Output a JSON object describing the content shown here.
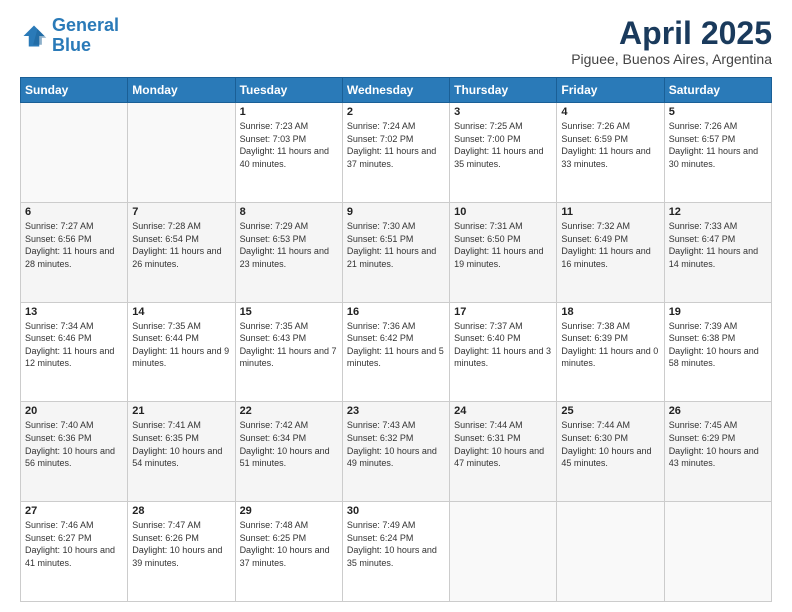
{
  "header": {
    "logo_line1": "General",
    "logo_line2": "Blue",
    "title": "April 2025",
    "subtitle": "Piguee, Buenos Aires, Argentina"
  },
  "weekdays": [
    "Sunday",
    "Monday",
    "Tuesday",
    "Wednesday",
    "Thursday",
    "Friday",
    "Saturday"
  ],
  "weeks": [
    [
      {
        "day": "",
        "info": ""
      },
      {
        "day": "",
        "info": ""
      },
      {
        "day": "1",
        "info": "Sunrise: 7:23 AM\nSunset: 7:03 PM\nDaylight: 11 hours and 40 minutes."
      },
      {
        "day": "2",
        "info": "Sunrise: 7:24 AM\nSunset: 7:02 PM\nDaylight: 11 hours and 37 minutes."
      },
      {
        "day": "3",
        "info": "Sunrise: 7:25 AM\nSunset: 7:00 PM\nDaylight: 11 hours and 35 minutes."
      },
      {
        "day": "4",
        "info": "Sunrise: 7:26 AM\nSunset: 6:59 PM\nDaylight: 11 hours and 33 minutes."
      },
      {
        "day": "5",
        "info": "Sunrise: 7:26 AM\nSunset: 6:57 PM\nDaylight: 11 hours and 30 minutes."
      }
    ],
    [
      {
        "day": "6",
        "info": "Sunrise: 7:27 AM\nSunset: 6:56 PM\nDaylight: 11 hours and 28 minutes."
      },
      {
        "day": "7",
        "info": "Sunrise: 7:28 AM\nSunset: 6:54 PM\nDaylight: 11 hours and 26 minutes."
      },
      {
        "day": "8",
        "info": "Sunrise: 7:29 AM\nSunset: 6:53 PM\nDaylight: 11 hours and 23 minutes."
      },
      {
        "day": "9",
        "info": "Sunrise: 7:30 AM\nSunset: 6:51 PM\nDaylight: 11 hours and 21 minutes."
      },
      {
        "day": "10",
        "info": "Sunrise: 7:31 AM\nSunset: 6:50 PM\nDaylight: 11 hours and 19 minutes."
      },
      {
        "day": "11",
        "info": "Sunrise: 7:32 AM\nSunset: 6:49 PM\nDaylight: 11 hours and 16 minutes."
      },
      {
        "day": "12",
        "info": "Sunrise: 7:33 AM\nSunset: 6:47 PM\nDaylight: 11 hours and 14 minutes."
      }
    ],
    [
      {
        "day": "13",
        "info": "Sunrise: 7:34 AM\nSunset: 6:46 PM\nDaylight: 11 hours and 12 minutes."
      },
      {
        "day": "14",
        "info": "Sunrise: 7:35 AM\nSunset: 6:44 PM\nDaylight: 11 hours and 9 minutes."
      },
      {
        "day": "15",
        "info": "Sunrise: 7:35 AM\nSunset: 6:43 PM\nDaylight: 11 hours and 7 minutes."
      },
      {
        "day": "16",
        "info": "Sunrise: 7:36 AM\nSunset: 6:42 PM\nDaylight: 11 hours and 5 minutes."
      },
      {
        "day": "17",
        "info": "Sunrise: 7:37 AM\nSunset: 6:40 PM\nDaylight: 11 hours and 3 minutes."
      },
      {
        "day": "18",
        "info": "Sunrise: 7:38 AM\nSunset: 6:39 PM\nDaylight: 11 hours and 0 minutes."
      },
      {
        "day": "19",
        "info": "Sunrise: 7:39 AM\nSunset: 6:38 PM\nDaylight: 10 hours and 58 minutes."
      }
    ],
    [
      {
        "day": "20",
        "info": "Sunrise: 7:40 AM\nSunset: 6:36 PM\nDaylight: 10 hours and 56 minutes."
      },
      {
        "day": "21",
        "info": "Sunrise: 7:41 AM\nSunset: 6:35 PM\nDaylight: 10 hours and 54 minutes."
      },
      {
        "day": "22",
        "info": "Sunrise: 7:42 AM\nSunset: 6:34 PM\nDaylight: 10 hours and 51 minutes."
      },
      {
        "day": "23",
        "info": "Sunrise: 7:43 AM\nSunset: 6:32 PM\nDaylight: 10 hours and 49 minutes."
      },
      {
        "day": "24",
        "info": "Sunrise: 7:44 AM\nSunset: 6:31 PM\nDaylight: 10 hours and 47 minutes."
      },
      {
        "day": "25",
        "info": "Sunrise: 7:44 AM\nSunset: 6:30 PM\nDaylight: 10 hours and 45 minutes."
      },
      {
        "day": "26",
        "info": "Sunrise: 7:45 AM\nSunset: 6:29 PM\nDaylight: 10 hours and 43 minutes."
      }
    ],
    [
      {
        "day": "27",
        "info": "Sunrise: 7:46 AM\nSunset: 6:27 PM\nDaylight: 10 hours and 41 minutes."
      },
      {
        "day": "28",
        "info": "Sunrise: 7:47 AM\nSunset: 6:26 PM\nDaylight: 10 hours and 39 minutes."
      },
      {
        "day": "29",
        "info": "Sunrise: 7:48 AM\nSunset: 6:25 PM\nDaylight: 10 hours and 37 minutes."
      },
      {
        "day": "30",
        "info": "Sunrise: 7:49 AM\nSunset: 6:24 PM\nDaylight: 10 hours and 35 minutes."
      },
      {
        "day": "",
        "info": ""
      },
      {
        "day": "",
        "info": ""
      },
      {
        "day": "",
        "info": ""
      }
    ]
  ]
}
